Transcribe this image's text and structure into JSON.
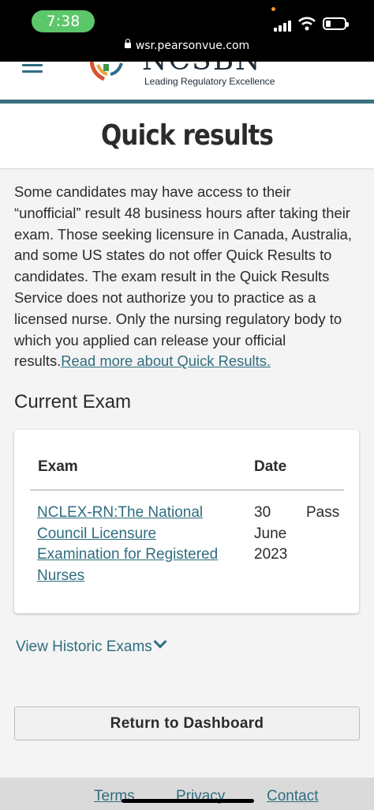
{
  "status_bar": {
    "time": "7:38",
    "url": "wsr.pearsonvue.com"
  },
  "header": {
    "logo_text": "NCSBN",
    "logo_tagline": "Leading Regulatory Excellence"
  },
  "page": {
    "title": "Quick results"
  },
  "intro": {
    "text": "Some candidates may have access to their “unofficial” result 48 business hours after taking their exam. Those seeking licensure in Canada, Australia, and some US states do not offer Quick Results to candidates.  The exam result in the Quick Results Service does not authorize you to practice as a licensed nurse. Only the nursing regulatory body to which you applied can release your official results.",
    "link": "Read more about Quick Results."
  },
  "current_exam": {
    "heading": "Current Exam",
    "columns": [
      "Exam",
      "Date"
    ],
    "row": {
      "exam": "NCLEX-RN:The National Council Licensure Examination for Registered Nurses",
      "date": "30 June 2023",
      "result": "Pass"
    }
  },
  "historic": {
    "label": "View Historic Exams"
  },
  "actions": {
    "dashboard": "Return to Dashboard"
  },
  "footer": {
    "links": [
      "Terms",
      "Privacy",
      "Contact"
    ]
  },
  "colors": {
    "accent": "#2f6d7f",
    "time_pill": "#5cc66a"
  }
}
